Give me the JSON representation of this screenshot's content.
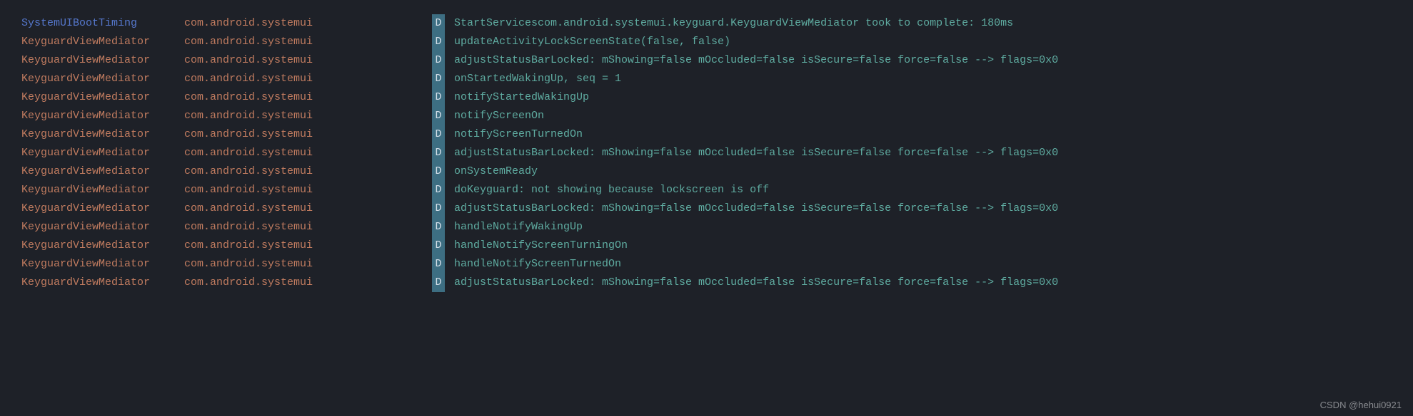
{
  "watermark": "CSDN @hehui0921",
  "rows": [
    {
      "tag": "SystemUIBootTiming",
      "tag_highlight": true,
      "package": "com.android.systemui",
      "level": "D",
      "message": "StartServicescom.android.systemui.keyguard.KeyguardViewMediator took to complete: 180ms"
    },
    {
      "tag": "KeyguardViewMediator",
      "tag_highlight": false,
      "package": "com.android.systemui",
      "level": "D",
      "message": "updateActivityLockScreenState(false, false)"
    },
    {
      "tag": "KeyguardViewMediator",
      "tag_highlight": false,
      "package": "com.android.systemui",
      "level": "D",
      "message": "adjustStatusBarLocked: mShowing=false mOccluded=false isSecure=false force=false --> flags=0x0"
    },
    {
      "tag": "KeyguardViewMediator",
      "tag_highlight": false,
      "package": "com.android.systemui",
      "level": "D",
      "message": "onStartedWakingUp, seq = 1"
    },
    {
      "tag": "KeyguardViewMediator",
      "tag_highlight": false,
      "package": "com.android.systemui",
      "level": "D",
      "message": "notifyStartedWakingUp"
    },
    {
      "tag": "KeyguardViewMediator",
      "tag_highlight": false,
      "package": "com.android.systemui",
      "level": "D",
      "message": "notifyScreenOn"
    },
    {
      "tag": "KeyguardViewMediator",
      "tag_highlight": false,
      "package": "com.android.systemui",
      "level": "D",
      "message": "notifyScreenTurnedOn"
    },
    {
      "tag": "KeyguardViewMediator",
      "tag_highlight": false,
      "package": "com.android.systemui",
      "level": "D",
      "message": "adjustStatusBarLocked: mShowing=false mOccluded=false isSecure=false force=false --> flags=0x0"
    },
    {
      "tag": "KeyguardViewMediator",
      "tag_highlight": false,
      "package": "com.android.systemui",
      "level": "D",
      "message": "onSystemReady"
    },
    {
      "tag": "KeyguardViewMediator",
      "tag_highlight": false,
      "package": "com.android.systemui",
      "level": "D",
      "message": "doKeyguard: not showing because lockscreen is off"
    },
    {
      "tag": "KeyguardViewMediator",
      "tag_highlight": false,
      "package": "com.android.systemui",
      "level": "D",
      "message": "adjustStatusBarLocked: mShowing=false mOccluded=false isSecure=false force=false --> flags=0x0"
    },
    {
      "tag": "KeyguardViewMediator",
      "tag_highlight": false,
      "package": "com.android.systemui",
      "level": "D",
      "message": "handleNotifyWakingUp"
    },
    {
      "tag": "KeyguardViewMediator",
      "tag_highlight": false,
      "package": "com.android.systemui",
      "level": "D",
      "message": "handleNotifyScreenTurningOn"
    },
    {
      "tag": "KeyguardViewMediator",
      "tag_highlight": false,
      "package": "com.android.systemui",
      "level": "D",
      "message": "handleNotifyScreenTurnedOn"
    },
    {
      "tag": "KeyguardViewMediator",
      "tag_highlight": false,
      "package": "com.android.systemui",
      "level": "D",
      "message": "adjustStatusBarLocked: mShowing=false mOccluded=false isSecure=false force=false --> flags=0x0"
    }
  ]
}
